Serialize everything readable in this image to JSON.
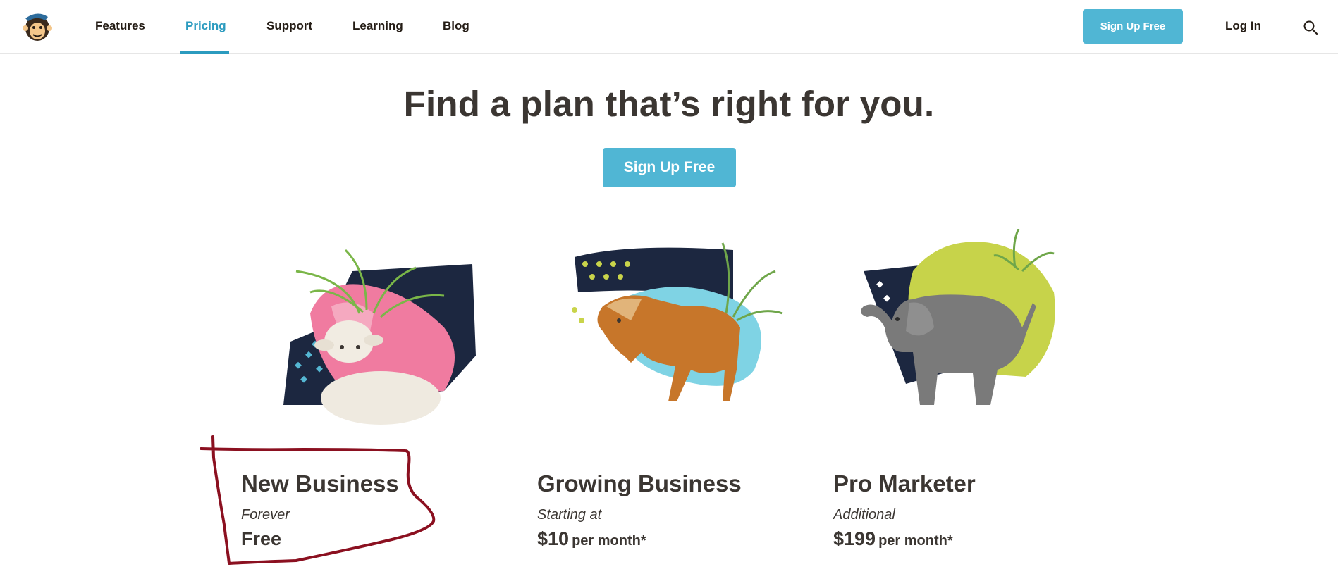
{
  "header": {
    "nav": [
      {
        "label": "Features",
        "active": false
      },
      {
        "label": "Pricing",
        "active": true
      },
      {
        "label": "Support",
        "active": false
      },
      {
        "label": "Learning",
        "active": false
      },
      {
        "label": "Blog",
        "active": false
      }
    ],
    "signup_label": "Sign Up Free",
    "login_label": "Log In",
    "search_icon": "search-icon",
    "logo_icon": "monkey-logo-icon"
  },
  "hero": {
    "title": "Find a plan that’s right for you.",
    "cta_label": "Sign Up Free"
  },
  "plans": [
    {
      "name": "New Business",
      "subtitle": "Forever",
      "price": "Free",
      "unit": "",
      "illustration": "lamb-illustration"
    },
    {
      "name": "Growing Business",
      "subtitle": "Starting at",
      "price": "$10",
      "unit": "per month*",
      "illustration": "horse-illustration"
    },
    {
      "name": "Pro Marketer",
      "subtitle": "Additional",
      "price": "$199",
      "unit": "per month*",
      "illustration": "elephant-illustration"
    }
  ],
  "colors": {
    "accent": "#50b6d4",
    "active_nav": "#2b9bbf",
    "text": "#3b3632",
    "annotation": "#8b1020"
  }
}
